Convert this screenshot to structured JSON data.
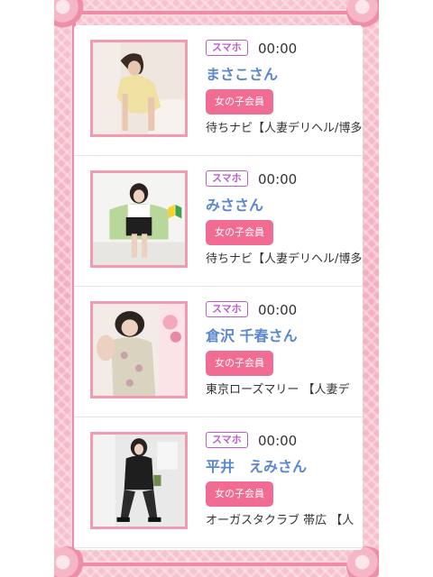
{
  "entries": [
    {
      "device": "スマホ",
      "time": "00:00",
      "name": "まさこさん",
      "member": "女の子会員",
      "shop": "待ちナビ【人妻デリヘル/博多",
      "photo": "photo-woman-yellow-dress",
      "beginner_mark": false
    },
    {
      "device": "スマホ",
      "time": "00:00",
      "name": "みささん",
      "member": "女の子会員",
      "shop": "待ちナビ【人妻デリヘル/博多",
      "photo": "photo-woman-green-chair",
      "beginner_mark": true
    },
    {
      "device": "スマホ",
      "time": "00:00",
      "name": "倉沢 千春さん",
      "member": "女の子会員",
      "shop": "東京ローズマリー 【人妻デ",
      "photo": "photo-woman-floral-dress",
      "beginner_mark": false
    },
    {
      "device": "スマホ",
      "time": "00:00",
      "name": "平井　えみさん",
      "member": "女の子会員",
      "shop": "オーガスタクラブ 帯広 【人",
      "photo": "photo-woman-black-outfit",
      "beginner_mark": false
    }
  ],
  "colors": {
    "accent_pink": "#f06c93",
    "frame_pink": "#f3aebf",
    "name_blue": "#5b86d0",
    "badge_purple": "#b85ec9"
  }
}
